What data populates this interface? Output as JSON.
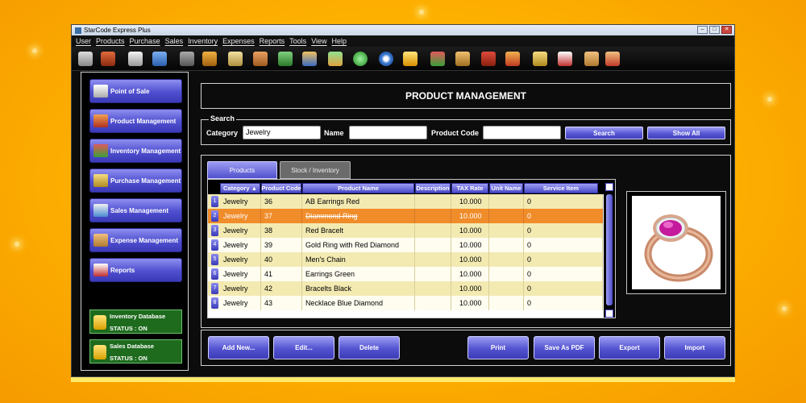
{
  "window": {
    "title": "StarCode Express Plus"
  },
  "menu": [
    "User",
    "Products",
    "Purchase",
    "Sales",
    "Inventory",
    "Expenses",
    "Reports",
    "Tools",
    "View",
    "Help"
  ],
  "toolbar_icons": [
    "logout-icon",
    "exit-icon",
    "pos-icon",
    "home-icon",
    "user-icon",
    "users-org-icon",
    "calendar-icon",
    "customers-icon",
    "cart-icon",
    "employee-icon",
    "chart-icon",
    "green-circle-icon",
    "settings-icon",
    "database-icon",
    "products-icon",
    "inventory-icon",
    "gift-icon",
    "box-icon",
    "purchase-icon",
    "report-icon",
    "folder-icon",
    "folder-export-icon"
  ],
  "sidebar": {
    "items": [
      {
        "label": "Point of Sale",
        "icon": "pos-icon"
      },
      {
        "label": "Product Management",
        "icon": "product-box-icon"
      },
      {
        "label": "Inventory Management",
        "icon": "inventory-icon"
      },
      {
        "label": "Purchase Management",
        "icon": "purchase-icon"
      },
      {
        "label": "Sales Management",
        "icon": "sales-icon"
      },
      {
        "label": "Expense Management",
        "icon": "expense-icon"
      },
      {
        "label": "Reports",
        "icon": "reports-icon"
      }
    ],
    "databases": [
      {
        "name": "Inventory Database",
        "status": "STATUS : ON"
      },
      {
        "name": "Sales Database",
        "status": "STATUS : ON"
      }
    ]
  },
  "page_title": "PRODUCT MANAGEMENT",
  "search": {
    "legend": "Search",
    "category_label": "Category",
    "category_value": "Jewelry",
    "name_label": "Name",
    "name_value": "",
    "code_label": "Product Code",
    "code_value": "",
    "search_btn": "Search",
    "showall_btn": "Show All"
  },
  "tabs": {
    "products": "Products",
    "stock": "Stock / Inventory"
  },
  "table": {
    "headers": [
      "Category",
      "Product Code",
      "Product Name",
      "Description",
      "TAX Rate",
      "Unit Name",
      "Service Item"
    ],
    "rows": [
      {
        "n": "1",
        "category": "Jewelry",
        "code": "36",
        "name": "AB Earrings Red",
        "desc": "",
        "tax": "10.000",
        "unit": "",
        "service": "0"
      },
      {
        "n": "2",
        "category": "Jewelry",
        "code": "37",
        "name": "Diammond Ring",
        "desc": "",
        "tax": "10.000",
        "unit": "",
        "service": "0"
      },
      {
        "n": "3",
        "category": "Jewelry",
        "code": "38",
        "name": "Red Bracelt",
        "desc": "",
        "tax": "10.000",
        "unit": "",
        "service": "0"
      },
      {
        "n": "4",
        "category": "Jewelry",
        "code": "39",
        "name": "Gold Ring with Red Diamond",
        "desc": "",
        "tax": "10.000",
        "unit": "",
        "service": "0"
      },
      {
        "n": "5",
        "category": "Jewelry",
        "code": "40",
        "name": "Men's Chain",
        "desc": "",
        "tax": "10.000",
        "unit": "",
        "service": "0"
      },
      {
        "n": "6",
        "category": "Jewelry",
        "code": "41",
        "name": "Earrings Green",
        "desc": "",
        "tax": "10.000",
        "unit": "",
        "service": "0"
      },
      {
        "n": "7",
        "category": "Jewelry",
        "code": "42",
        "name": "Bracelts Black",
        "desc": "",
        "tax": "10.000",
        "unit": "",
        "service": "0"
      },
      {
        "n": "8",
        "category": "Jewelry",
        "code": "43",
        "name": "Necklace Blue Diamond",
        "desc": "",
        "tax": "10.000",
        "unit": "",
        "service": "0"
      }
    ]
  },
  "actions": {
    "add": "Add New...",
    "edit": "Edit...",
    "delete": "Delete",
    "print": "Print",
    "pdf": "Save As PDF",
    "export": "Export",
    "import": "Import"
  }
}
